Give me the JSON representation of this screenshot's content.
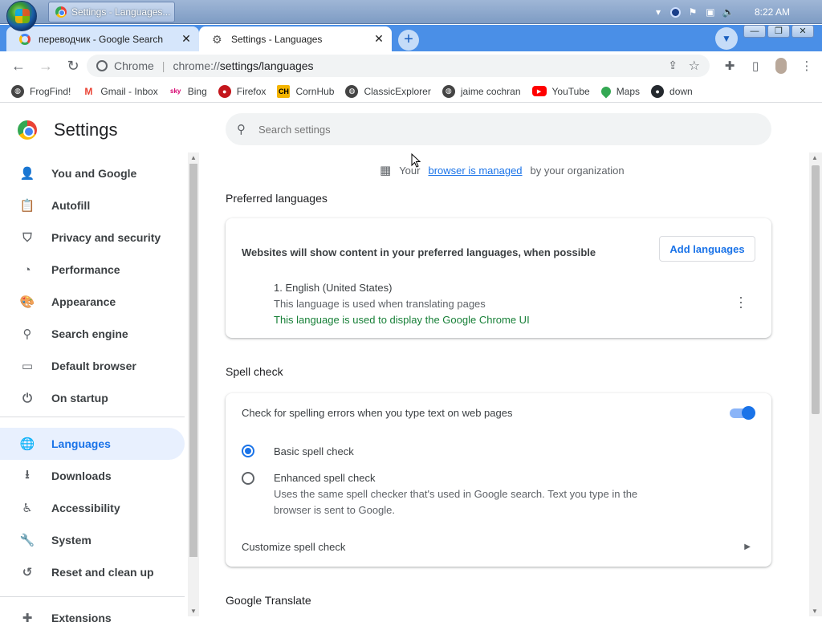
{
  "os": {
    "taskbar_item": "Settings - Languages...",
    "clock": "8:22 AM"
  },
  "tabs": [
    {
      "title": "переводчик - Google Search",
      "close": "✕",
      "icon": "google-icon"
    },
    {
      "title": "Settings - Languages",
      "close": "✕",
      "icon": "gear-icon"
    }
  ],
  "newtab_label": "+",
  "omnibox": {
    "site": "Chrome",
    "url_scheme": "chrome://",
    "url_path": "settings/languages"
  },
  "bookmarks": [
    {
      "label": "FrogFind!",
      "icon": "globe-icon",
      "color": "#444444"
    },
    {
      "label": "Gmail - Inbox",
      "icon": "gmail-icon",
      "color": "#ea4335"
    },
    {
      "label": "Bing",
      "icon": "sky-icon",
      "color": "#d6006e"
    },
    {
      "label": "Firefox",
      "icon": "firefox-icon",
      "color": "#c4161c"
    },
    {
      "label": "CornHub",
      "icon": "ch-icon",
      "color": "#f4b400"
    },
    {
      "label": "ClassicExplorer",
      "icon": "globe-icon",
      "color": "#444444"
    },
    {
      "label": "jaime cochran",
      "icon": "globe-icon",
      "color": "#444444"
    },
    {
      "label": "YouTube",
      "icon": "youtube-icon",
      "color": "#ff0000"
    },
    {
      "label": "Maps",
      "icon": "maps-icon",
      "color": "#34a853"
    },
    {
      "label": "down",
      "icon": "github-icon",
      "color": "#24292e"
    }
  ],
  "settings": {
    "title": "Settings",
    "search_placeholder": "Search settings",
    "sidebar": [
      {
        "label": "You and Google",
        "icon": "person-icon"
      },
      {
        "label": "Autofill",
        "icon": "clipboard-icon"
      },
      {
        "label": "Privacy and security",
        "icon": "shield-icon"
      },
      {
        "label": "Performance",
        "icon": "speedometer-icon"
      },
      {
        "label": "Appearance",
        "icon": "palette-icon"
      },
      {
        "label": "Search engine",
        "icon": "search-icon"
      },
      {
        "label": "Default browser",
        "icon": "browser-icon"
      },
      {
        "label": "On startup",
        "icon": "power-icon"
      },
      {
        "label": "Languages",
        "icon": "globe-icon",
        "active": true
      },
      {
        "label": "Downloads",
        "icon": "download-icon"
      },
      {
        "label": "Accessibility",
        "icon": "accessibility-icon"
      },
      {
        "label": "System",
        "icon": "wrench-icon"
      },
      {
        "label": "Reset and clean up",
        "icon": "restore-icon"
      },
      {
        "label": "Extensions",
        "icon": "puzzle-icon"
      }
    ],
    "managed": {
      "prefix": "Your",
      "link": "browser is managed",
      "suffix": "by your organization"
    },
    "preferred": {
      "title": "Preferred languages",
      "description": "Websites will show content in your preferred languages, when possible",
      "add_button": "Add languages",
      "language": "1. English (United States)",
      "translate_note": "This language is used when translating pages",
      "ui_note": "This language is used to display the Google Chrome UI"
    },
    "spell": {
      "title": "Spell check",
      "toggle_label": "Check for spelling errors when you type text on web pages",
      "toggle_on": true,
      "basic": "Basic spell check",
      "enhanced": "Enhanced spell check",
      "enhanced_desc": "Uses the same spell checker that's used in Google search. Text you type in the browser is sent to Google.",
      "customize": "Customize spell check"
    },
    "translate": {
      "title": "Google Translate"
    }
  }
}
